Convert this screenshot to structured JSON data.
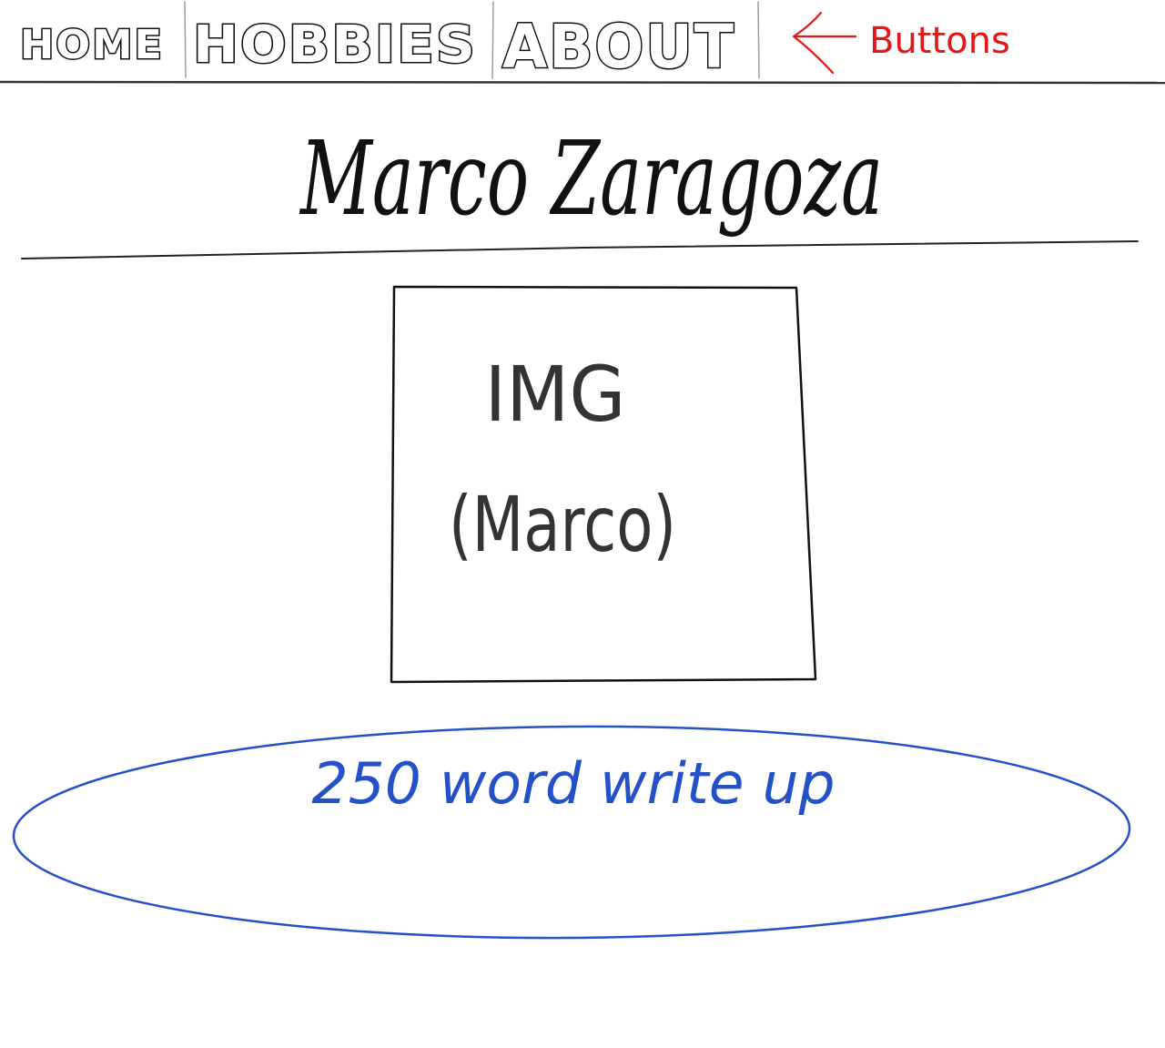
{
  "nav": {
    "buttons": [
      {
        "label": "HOME"
      },
      {
        "label": "HOBBIES"
      },
      {
        "label": "ABOUT"
      }
    ],
    "annotation": "Buttons"
  },
  "header": {
    "title": "Marco Zaragoza"
  },
  "image_placeholder": {
    "line1": "IMG",
    "line2": "(Marco)"
  },
  "writeup": {
    "label": "250 word write up"
  },
  "colors": {
    "ink": "#111111",
    "annotation_red": "#e01818",
    "writeup_blue": "#2450c8"
  },
  "icons": {
    "annotation_arrow": "arrow-left-icon"
  }
}
